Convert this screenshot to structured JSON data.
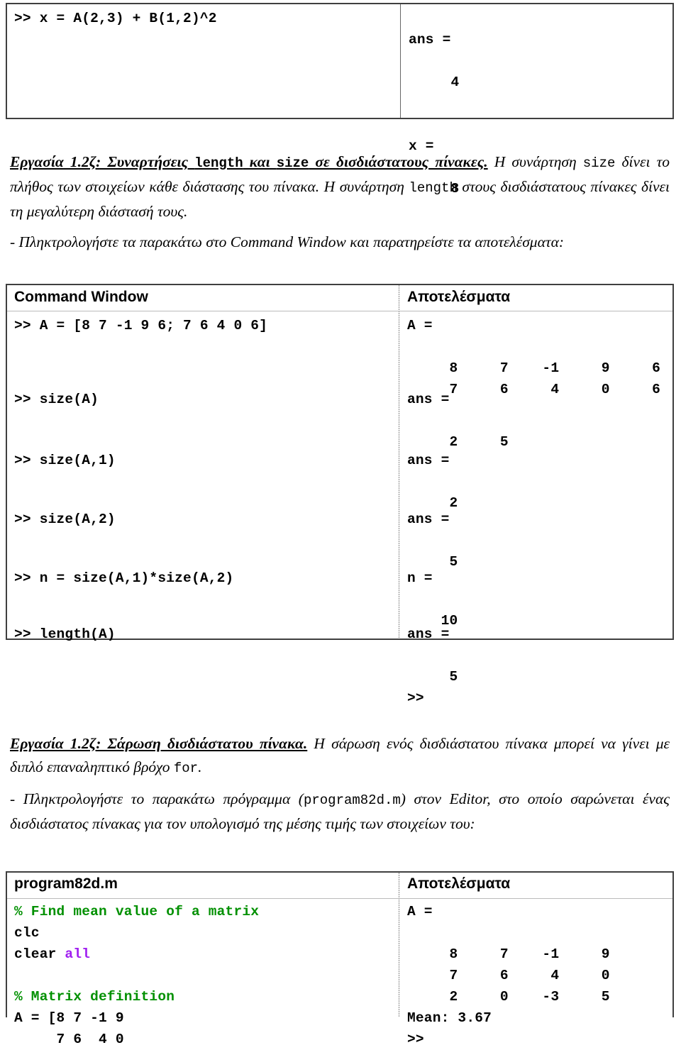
{
  "top_table": {
    "left_column": {
      "lines": [
        ">> x = A(2,3) + B(1,2)^2"
      ]
    },
    "right_column": {
      "text": "\nans =\n\n     4\n\n\nx =\n\n     8"
    }
  },
  "section_1": {
    "heading": "Εργασία 1.2ζ: Συναρτήσεις length και size σε δισδιάστατους πίνακες.",
    "heading_code_1": "length",
    "heading_code_2": "size",
    "body_part_1": " Η συνάρτηση ",
    "body_code_1": "size",
    "body_part_2": " δίνει το πλήθος των στοιχείων κάθε διάστασης του πίνακα. Η συνάρτηση ",
    "body_code_2": "length",
    "body_part_3": " στους δισδιάστατους πίνακες δίνει τη μεγαλύτερη διάστασή τους.",
    "instruction": "- Πληκτρολογήστε τα παρακάτω στο Command Window και παρατηρείστε τα αποτελέσματα:"
  },
  "command_table": {
    "header_left": "Command Window",
    "header_right": "Αποτελέσματα",
    "rows": [
      {
        "command": ">> A = [8 7 -1 9 6; 7 6 4 0 6]",
        "result": "A =\n\n     8     7    -1     9     6\n     7     6     4     0     6\n"
      },
      {
        "command": ">> size(A)",
        "result": "ans =\n\n     2     5\n"
      },
      {
        "command": ">> size(A,1)",
        "result": "ans =\n\n     2\n"
      },
      {
        "command": ">> size(A,2)",
        "result": "ans =\n\n     5\n"
      },
      {
        "command": ">> n = size(A,1)*size(A,2)",
        "result": "n =\n\n    10\n"
      },
      {
        "command": ">> length(A)",
        "result": "ans =\n\n     5\n>>"
      }
    ]
  },
  "section_2": {
    "heading": "Εργασία 1.2ζ: Σάρωση δισδιάστατου πίνακα.",
    "body_part_1": " Η σάρωση ενός δισδιάστατου πίνακα μπορεί να γίνει με διπλό επαναληπτικό βρόχο ",
    "body_code_1": "for",
    "body_part_2": ".",
    "instruction_part_1": "- Πληκτρολογήστε το παρακάτω πρόγραμμα (",
    "instruction_code": "program82d.m",
    "instruction_part_2": ") στον Editor, στο οποίο σαρώνεται ένας δισδιάστατος πίνακας για τον υπολογισμό της μέσης τιμής των στοιχείων του:"
  },
  "program_table": {
    "header_left": "program82d.m",
    "header_right": "Αποτελέσματα",
    "code_lines": [
      {
        "text": "% Find mean value of a matrix",
        "style": "comment"
      },
      {
        "text": "clc",
        "style": "plain"
      },
      {
        "text": "clear ",
        "style": "plain",
        "keyword": "all"
      },
      {
        "text": "",
        "style": "plain"
      },
      {
        "text": "% Matrix definition",
        "style": "comment"
      },
      {
        "text": "A = [8 7 -1 9",
        "style": "plain"
      },
      {
        "text": "     7 6  4 0",
        "style": "plain"
      }
    ],
    "result": "A =\n\n     8     7    -1     9\n     7     6     4     0\n     2     0    -3     5\nMean: 3.67\n>>"
  },
  "colors": {
    "comment_green": "#009000",
    "keyword_purple": "#a020f0",
    "border_gray": "#3f3f3f",
    "divider_gray": "#8a8a8a",
    "text_black": "#000000"
  }
}
